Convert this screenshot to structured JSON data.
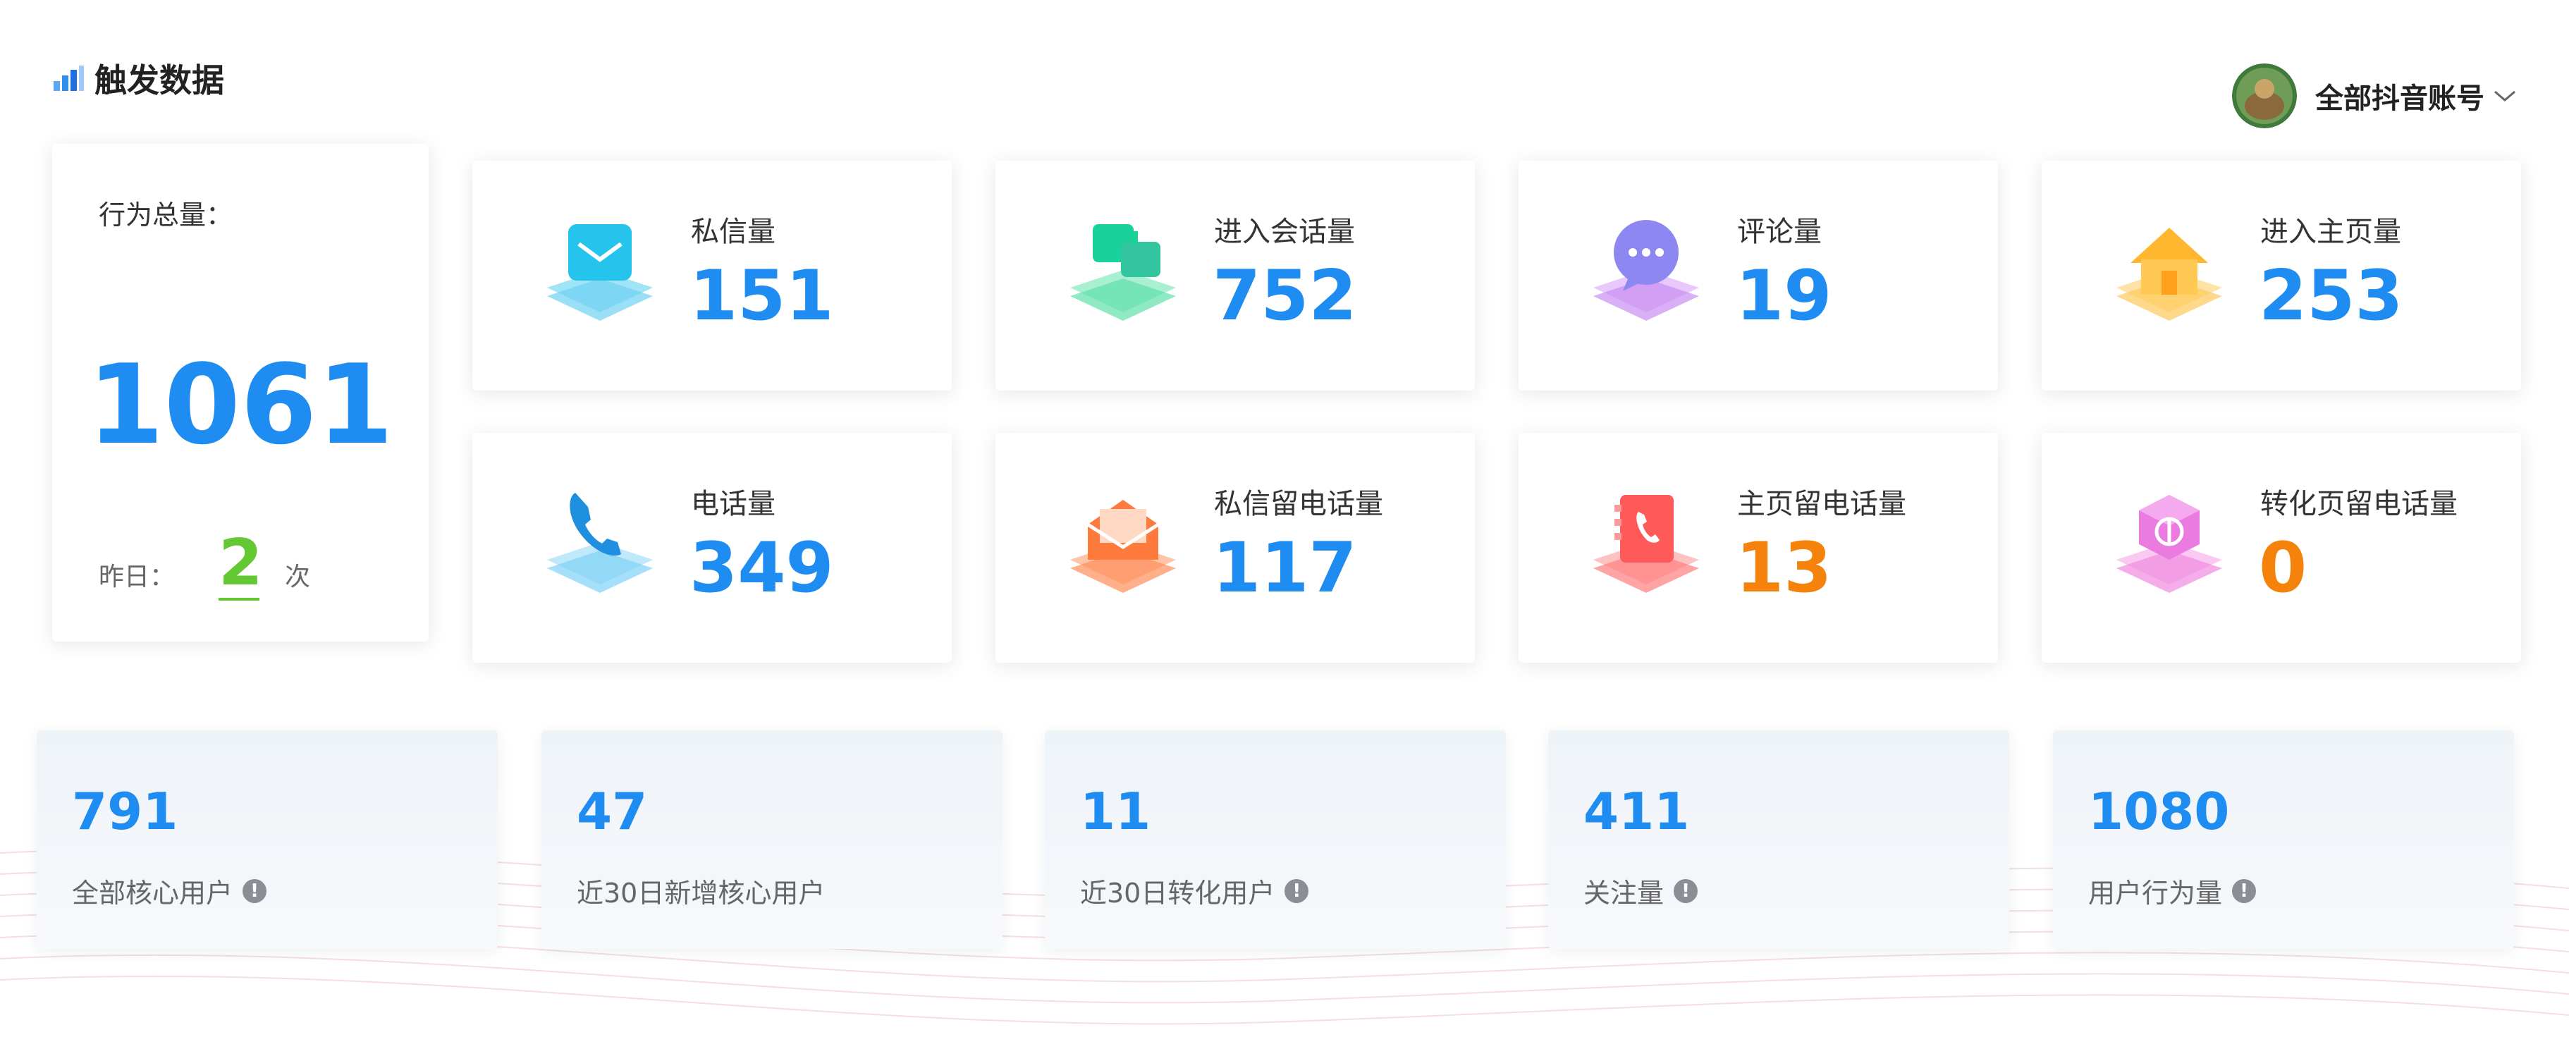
{
  "header": {
    "title": "触发数据",
    "title_icon": "bar-chart-icon"
  },
  "account": {
    "name": "全部抖音账号",
    "dropdown_icon": "chevron-down-icon"
  },
  "total": {
    "label": "行为总量：",
    "value": "1061",
    "yesterday_label": "昨日：",
    "yesterday_value": "2",
    "yesterday_unit": "次"
  },
  "metrics": [
    {
      "label": "私信量",
      "value": "151",
      "icon": "message-icon",
      "color": "#1e8cf0"
    },
    {
      "label": "进入会话量",
      "value": "752",
      "icon": "chat-bubbles-icon",
      "color": "#1e8cf0"
    },
    {
      "label": "评论量",
      "value": "19",
      "icon": "comment-icon",
      "color": "#1e8cf0"
    },
    {
      "label": "进入主页量",
      "value": "253",
      "icon": "home-icon",
      "color": "#1e8cf0"
    },
    {
      "label": "电话量",
      "value": "349",
      "icon": "phone-icon",
      "color": "#1e8cf0"
    },
    {
      "label": "私信留电话量",
      "value": "117",
      "icon": "mail-open-icon",
      "color": "#1e8cf0"
    },
    {
      "label": "主页留电话量",
      "value": "13",
      "icon": "phone-book-icon",
      "color": "#f5820a"
    },
    {
      "label": "转化页留电话量",
      "value": "0",
      "icon": "conversion-cube-icon",
      "color": "#f5820a"
    }
  ],
  "stats": [
    {
      "value": "791",
      "label": "全部核心用户",
      "info": true
    },
    {
      "value": "47",
      "label": "近30日新增核心用户",
      "info": false
    },
    {
      "value": "11",
      "label": "近30日转化用户",
      "info": true
    },
    {
      "value": "411",
      "label": "关注量",
      "info": true
    },
    {
      "value": "1080",
      "label": "用户行为量",
      "info": true
    }
  ],
  "info_glyph": "!"
}
